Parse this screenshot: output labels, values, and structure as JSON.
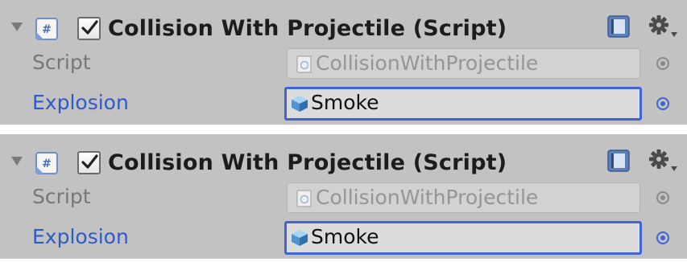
{
  "components": [
    {
      "title": "Collision With Projectile (Script)",
      "enabled": true,
      "icons": {
        "foldout": "foldout-triangle-icon",
        "script": "cs-script-icon",
        "help": "help-book-icon",
        "settings": "gear-dropdown-icon"
      },
      "fields": [
        {
          "label": "Script",
          "value": "CollisionWithProjectile",
          "icon": "script-asset-icon",
          "state": "disabled"
        },
        {
          "label": "Explosion",
          "value": "Smoke",
          "icon": "prefab-cube-icon",
          "state": "focused"
        }
      ]
    },
    {
      "title": "Collision With Projectile (Script)",
      "enabled": true,
      "icons": {
        "foldout": "foldout-triangle-icon",
        "script": "cs-script-icon",
        "help": "help-book-icon",
        "settings": "gear-dropdown-icon"
      },
      "fields": [
        {
          "label": "Script",
          "value": "CollisionWithProjectile",
          "icon": "script-asset-icon",
          "state": "disabled"
        },
        {
          "label": "Explosion",
          "value": "Smoke",
          "icon": "prefab-cube-icon",
          "state": "focused"
        }
      ]
    }
  ],
  "colors": {
    "panel_bg": "#c2c2c2",
    "label_dim": "#777777",
    "label_focused": "#2f5bc6",
    "focus_border": "#3e64d6"
  }
}
